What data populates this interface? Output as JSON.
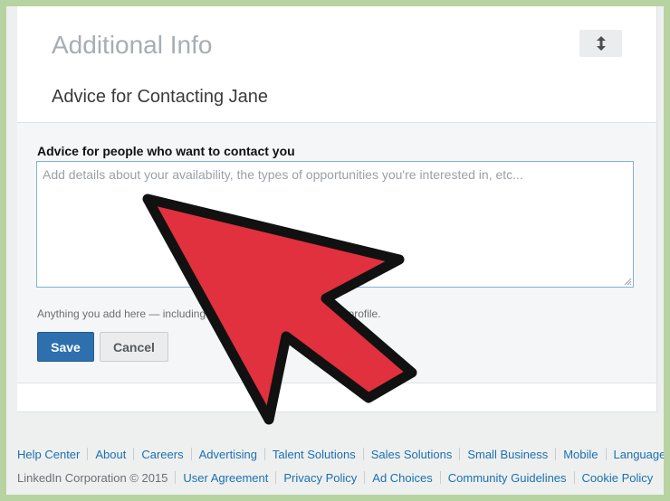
{
  "section": {
    "title": "Additional Info",
    "subtitle": "Advice for Contacting Jane",
    "reorder_icon": "up-down-arrow-icon"
  },
  "form": {
    "label": "Advice for people who want to contact you",
    "placeholder": "Add details about your availability, the types of opportunities you're interested in, etc...",
    "value": "",
    "help_text": "Anything you add here — including                                                    ible to people who view your profile.",
    "save_label": "Save",
    "cancel_label": "Cancel"
  },
  "footer": {
    "links": [
      {
        "label": "Help Center"
      },
      {
        "label": "About"
      },
      {
        "label": "Careers"
      },
      {
        "label": "Advertising"
      },
      {
        "label": "Talent Solutions"
      },
      {
        "label": "Sales Solutions"
      },
      {
        "label": "Small Business"
      },
      {
        "label": "Mobile"
      },
      {
        "label": "Language"
      }
    ],
    "copyright": "LinkedIn Corporation © 2015",
    "legal_links": [
      {
        "label": "User Agreement"
      },
      {
        "label": "Privacy Policy"
      },
      {
        "label": "Ad Choices"
      },
      {
        "label": "Community Guidelines"
      },
      {
        "label": "Cookie Policy"
      }
    ]
  },
  "overlay": {
    "icon": "pointer-arrow-icon",
    "fill_color": "#e1303e",
    "stroke_color": "#111111"
  },
  "colors": {
    "background_border": "#b7d3a2",
    "save_button": "#2d70ad",
    "link": "#1c6fb0"
  }
}
